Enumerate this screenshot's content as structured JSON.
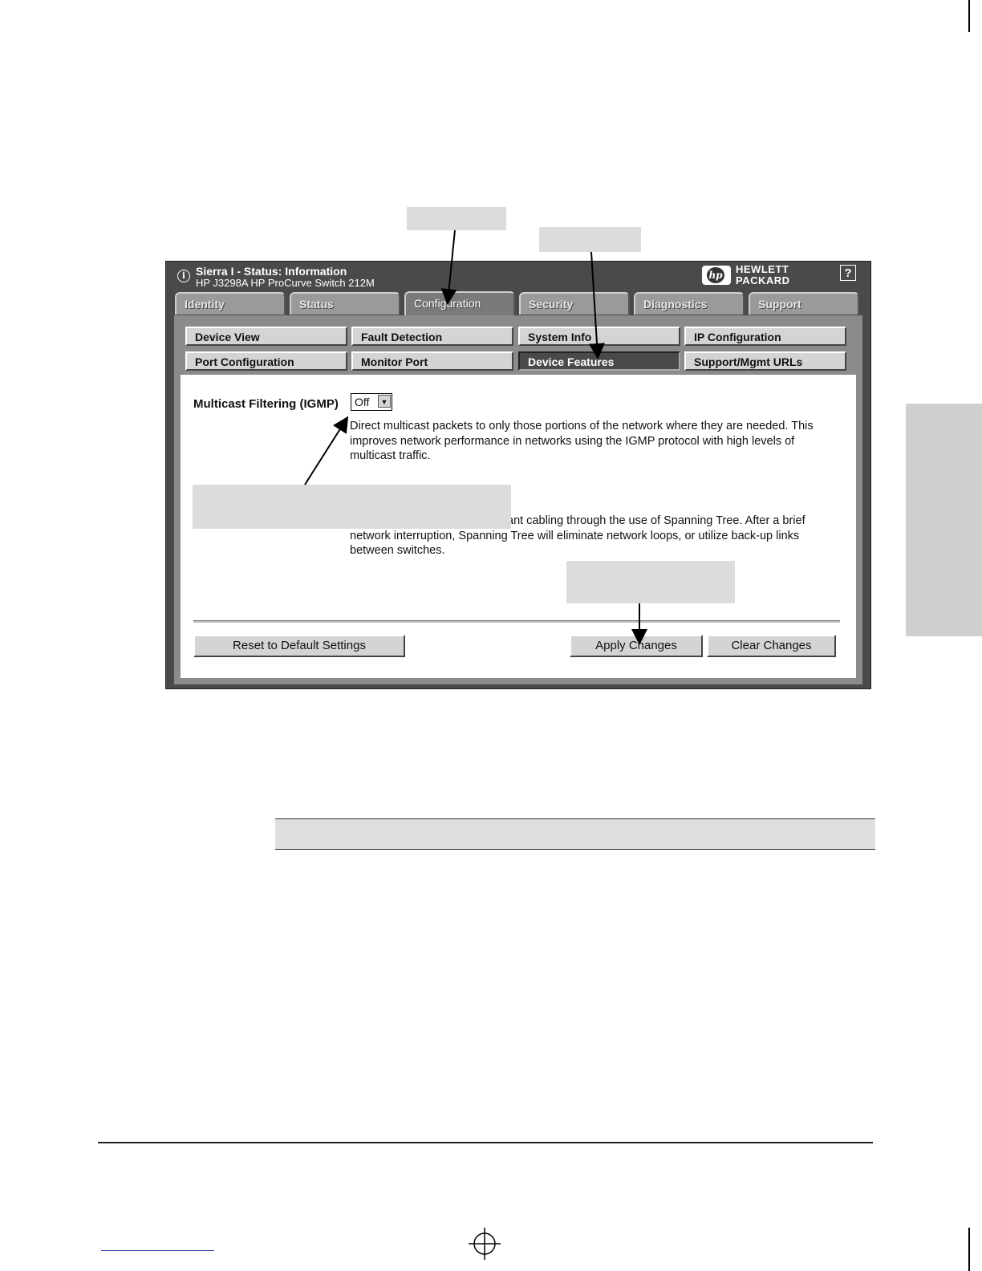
{
  "window": {
    "title": "Sierra I - Status:  Information",
    "subtitle": "HP J3298A HP ProCurve Switch 212M",
    "info_icon": "i",
    "brand_logo_text": "hp",
    "brand_name_line1": "HEWLETT",
    "brand_name_line2": "PACKARD",
    "help_label": "?"
  },
  "tabs": [
    {
      "label": "Identity"
    },
    {
      "label": "Status"
    },
    {
      "label": "Configuration",
      "active": true
    },
    {
      "label": "Security"
    },
    {
      "label": "Diagnostics"
    },
    {
      "label": "Support"
    }
  ],
  "subnav": [
    {
      "label": "Device View"
    },
    {
      "label": "Fault Detection"
    },
    {
      "label": "System Info"
    },
    {
      "label": "IP Configuration"
    },
    {
      "label": "Port Configuration"
    },
    {
      "label": "Monitor Port"
    },
    {
      "label": "Device Features",
      "active": true
    },
    {
      "label": "Support/Mgmt URLs"
    }
  ],
  "igmp": {
    "label": "Multicast Filtering (IGMP)",
    "selected": "Off",
    "description": "Direct multicast packets to only those portions of the network where they are needed. This improves network performance in networks using the IGMP protocol with high levels of multicast traffic."
  },
  "spanning_tree": {
    "description_visible": "ant cabling through the use of Spanning Tree. After a brief network interruption, Spanning Tree will eliminate network loops, or utilize back-up links between switches."
  },
  "actions": {
    "reset_label": "Reset to Default Settings",
    "apply_label": "Apply Changes",
    "clear_label": "Clear Changes"
  },
  "colors": {
    "frame": "#4a4a4a",
    "panel": "#8b8b8b",
    "button": "#d4d4d4",
    "active_button": "#4a4a4a",
    "callout": "#dcdcdc"
  }
}
